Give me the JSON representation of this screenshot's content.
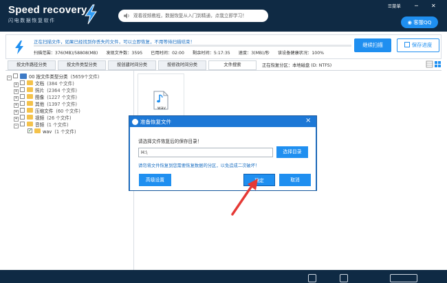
{
  "app": {
    "logo_title": "Speed recovery",
    "logo_subtitle": "闪电数据恢复软件",
    "notice": "观看视频教程，数据恢复从入门到精通，点我立即学习！",
    "menu_label": "菜单",
    "qq_label": "客服QQ"
  },
  "status": {
    "scan_text": "正在扫描文件，如果已经找到你丢失的文件，可以立即恢复，不用等待扫描结束！",
    "progress": 0,
    "stats": {
      "range": "扫描范围：376(MB)/58808(MB)",
      "found": "发现文件数：3595",
      "elapsed": "已用时间：02:00",
      "remaining": "剩余时间：5:17:35",
      "speed": "速度：3(MB)/秒",
      "health": "该设备健康状况：100%"
    },
    "continue_label": "继续扫描",
    "save_label": "保存进度"
  },
  "tabs": [
    {
      "label": "按文件路径分类"
    },
    {
      "label": "按文件类型分类"
    },
    {
      "label": "按创建时间分类"
    },
    {
      "label": "按修改时间分类"
    },
    {
      "label": "文件搜索"
    }
  ],
  "recover_info": "正在恢复分区：本地磁盘 (D: NTFS)",
  "tree": [
    {
      "indent": 0,
      "label": "00  按文件类型分类",
      "count": "(5659个文件)",
      "type": "root"
    },
    {
      "indent": 1,
      "label": "文档",
      "count": "(384 个文件)"
    },
    {
      "indent": 1,
      "label": "照片",
      "count": "(2364 个文件)"
    },
    {
      "indent": 1,
      "label": "图像",
      "count": "(1227 个文件)"
    },
    {
      "indent": 1,
      "label": "其他",
      "count": "(1397 个文件)"
    },
    {
      "indent": 1,
      "label": "压缩文件",
      "count": "(60 个文件)"
    },
    {
      "indent": 1,
      "label": "视频",
      "count": "(26 个文件)"
    },
    {
      "indent": 1,
      "label": "音频",
      "count": "(1 个文件)",
      "expanded": true
    },
    {
      "indent": 2,
      "label": "wav",
      "count": "(1 个文件)",
      "checked": true
    }
  ],
  "files": [
    {
      "name": "wav",
      "icon": "music-note-icon"
    }
  ],
  "dialog": {
    "title": "准备恢复文件",
    "prompt": "请选择文件恢复后的保存目录！",
    "path": "H:\\",
    "browse_label": "选择目录",
    "warning": "请勿将文件恢复到您需要恢复数据的分区，以免造成二次破坏！",
    "advanced_label": "高级设置",
    "ok_label": "确定",
    "cancel_label": "取消"
  },
  "colors": {
    "header_bg": "#0f2a44",
    "accent": "#1f8ff0",
    "dialog_frame": "#1d78d6",
    "arrow": "#e53935"
  }
}
